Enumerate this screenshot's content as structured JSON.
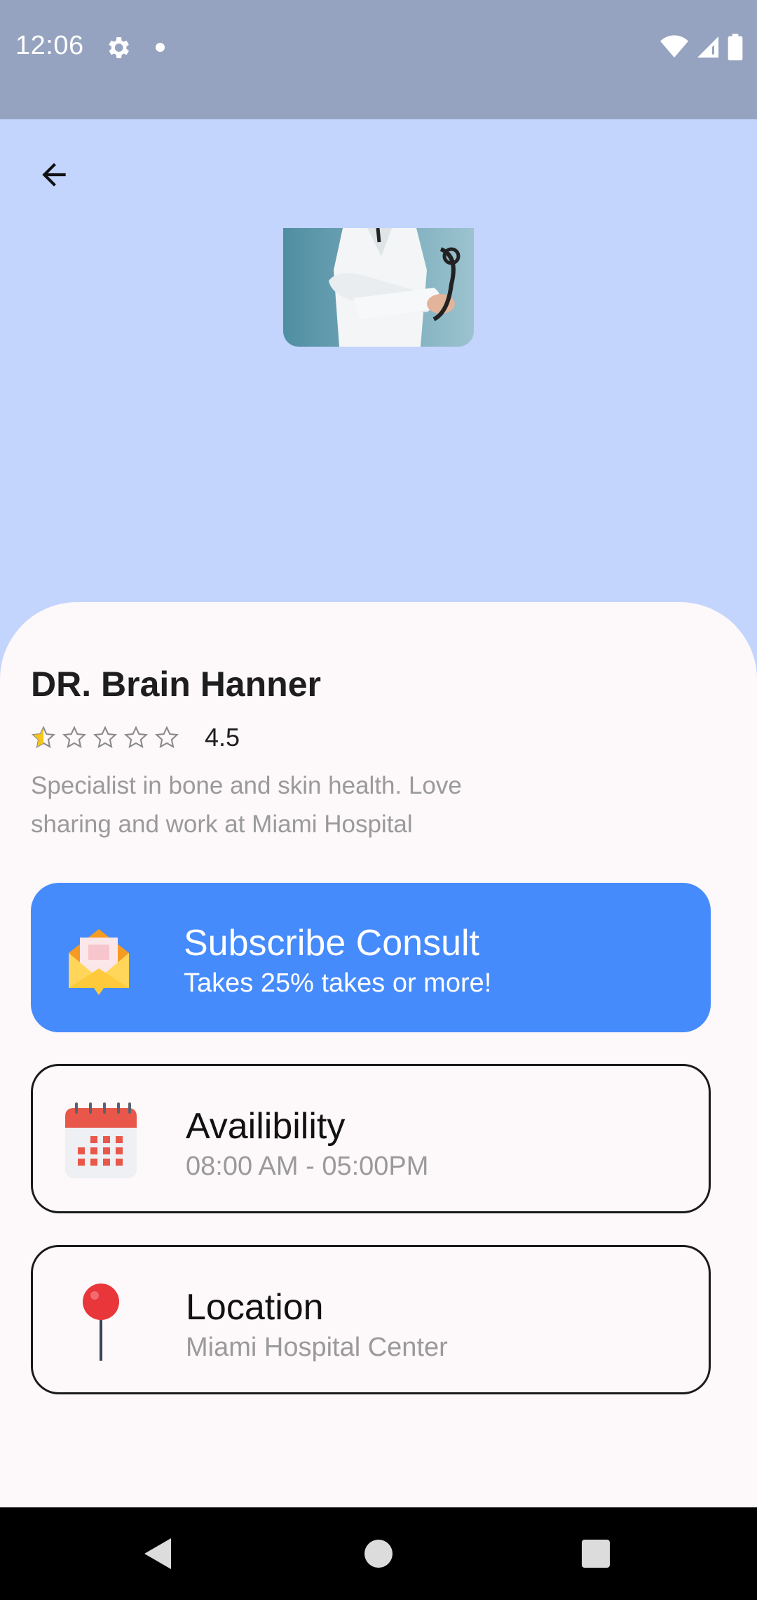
{
  "status_bar": {
    "time": "12:06"
  },
  "doctor": {
    "name": "DR. Brain Hanner",
    "rating": 4.5,
    "rating_label": "4.5",
    "stars_filled_fraction": 0.1,
    "bio": "Specialist in bone and skin health. Love sharing and work at Miami Hospital"
  },
  "tiles": {
    "subscribe": {
      "title": "Subscribe Consult",
      "subtitle": "Takes 25% takes or more!",
      "icon": "envelope-icon"
    },
    "availability": {
      "title": "Availibility",
      "subtitle": "08:00 AM - 05:00PM",
      "icon": "calendar-icon"
    },
    "location": {
      "title": "Location",
      "subtitle": "Miami Hospital Center",
      "icon": "map-pin-icon"
    }
  },
  "colors": {
    "header_bg": "#c3d4fd",
    "status_bar_bg": "#95a3c0",
    "accent_blue": "#468bfc",
    "star_yellow": "#f5c518",
    "sheet_bg": "#fdf8f9"
  }
}
